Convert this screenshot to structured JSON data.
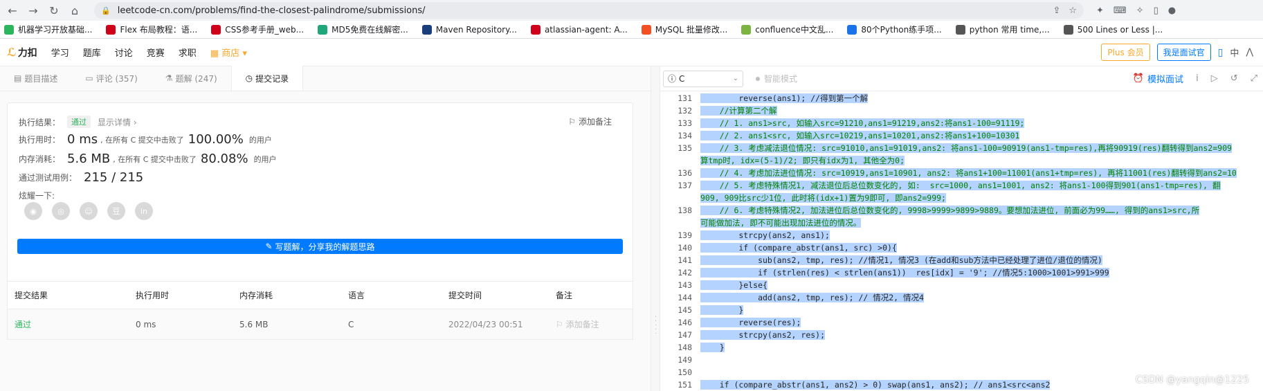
{
  "browser": {
    "url": "leetcode-cn.com/problems/find-the-closest-palindrome/submissions/",
    "bookmarks": [
      {
        "label": "机器学习开放基础...",
        "color": "#2db55d"
      },
      {
        "label": "Flex 布局教程：语...",
        "color": "#d0021b"
      },
      {
        "label": "CSS参考手册_web...",
        "color": "#d0021b"
      },
      {
        "label": "MD5免费在线解密...",
        "color": "#1fa67a"
      },
      {
        "label": "Maven Repository...",
        "color": "#1a3d7c"
      },
      {
        "label": "atlassian-agent: A...",
        "color": "#d0021b"
      },
      {
        "label": "MySQL 批量修改...",
        "color": "#f25022"
      },
      {
        "label": "confluence中文乱...",
        "color": "#7cb342"
      },
      {
        "label": "80个Python练手项...",
        "color": "#1a73e8"
      },
      {
        "label": "python 常用 time,...",
        "color": "#555555"
      },
      {
        "label": "500 Lines or Less |...",
        "color": "#555555"
      }
    ]
  },
  "site": {
    "logo": "力扣",
    "nav": [
      "学习",
      "题库",
      "讨论",
      "竞赛",
      "求职"
    ],
    "shop": "商店",
    "plus": "Plus 会员",
    "interview": "我是面试官",
    "lang": "中"
  },
  "tabs": [
    {
      "label": "题目描述",
      "icon": "▤"
    },
    {
      "label": "评论 (357)",
      "icon": "▭"
    },
    {
      "label": "题解 (247)",
      "icon": "⚗"
    },
    {
      "label": "提交记录",
      "icon": "◷"
    }
  ],
  "result": {
    "status_label": "执行结果：",
    "status": "通过",
    "show_detail": "显示详情 ›",
    "add_note": "添加备注",
    "time_label": "执行用时：",
    "time_value": "0 ms",
    "time_beat_text": ", 在所有 C 提交中击败了",
    "time_beat": "100.00%",
    "users": "的用户",
    "mem_label": "内存消耗：",
    "mem_value": "5.6 MB",
    "mem_beat_text": ", 在所有 C 提交中击败了",
    "mem_beat": "80.08%",
    "cases_label": "通过测试用例：",
    "cases_value": "215 / 215",
    "share_label": "炫耀一下:",
    "write_solution": "写题解，分享我的解题思路"
  },
  "table": {
    "headers": [
      "提交结果",
      "执行用时",
      "内存消耗",
      "语言",
      "提交时间",
      "备注"
    ],
    "rows": [
      {
        "result": "通过",
        "time": "0 ms",
        "mem": "5.6 MB",
        "lang": "C",
        "submitted": "2022/04/23 00:51",
        "note": "添加备注"
      }
    ]
  },
  "editor": {
    "language": "C",
    "smart_mode": "智能模式",
    "mock_interview": "模拟面试",
    "lines": [
      {
        "n": "131",
        "text": "        reverse(ans1); //得到第一个解"
      },
      {
        "n": "",
        "text": "    //计算第二个解"
      },
      {
        "n": "132",
        "text": "    //计算第二个解"
      },
      {
        "n": "133",
        "text": "    // 1. ans1>src, 如输入src=91210,ans1=91219,ans2:将ans1-100=91119;"
      },
      {
        "n": "134",
        "text": "    // 2. ans1<src, 如输入src=10219,ans1=10201,ans2:将ans1+100=10301"
      },
      {
        "n": "135",
        "text": "    // 3. 考虑减法退位情况: src=91010,ans1=91019,ans2: 将ans1-100=90919(ans1-tmp=res),再将90919(res)翻转得到ans2=909"
      },
      {
        "n": "",
        "text": "算tmp时, idx=(5-1)/2; 即只有idx为1, 其他全为0;"
      },
      {
        "n": "136",
        "text": "    // 4. 考虑加法进位情况: src=10919,ans1=10901, ans2: 将ans1+100=11001(ans1+tmp=res), 再将11001(res)翻转得到ans2=10"
      },
      {
        "n": "137",
        "text": "    // 5. 考虑特殊情况1, 减法退位后总位数变化的, 如:  src=1000, ans1=1001, ans2: 将ans1-100得到901(ans1-tmp=res), 翻"
      },
      {
        "n": "",
        "text": "909, 909比src少1位, 此时将(idx+1)置为9即可, 即ans2=999;"
      },
      {
        "n": "138",
        "text": "    // 6. 考虑特殊情况2, 加法进位后总位数变化的, 9998>9999>9899>9889。要想加法进位, 前面必为99……, 得到的ans1>src,所"
      },
      {
        "n": "",
        "text": "可能做加法, 即不可能出现加法进位的情况。"
      },
      {
        "n": "139",
        "text": "        strcpy(ans2, ans1);"
      },
      {
        "n": "140",
        "text": "        if (compare_abstr(ans1, src) >0){"
      },
      {
        "n": "141",
        "text": "            sub(ans2, tmp, res); //情况1, 情况3 (在add和sub方法中已经处理了进位/退位的情况)"
      },
      {
        "n": "142",
        "text": "            if (strlen(res) < strlen(ans1))  res[idx] = '9'; //情况5:1000>1001>991>999"
      },
      {
        "n": "143",
        "text": "        }else{"
      },
      {
        "n": "144",
        "text": "            add(ans2, tmp, res); // 情况2, 情况4"
      },
      {
        "n": "145",
        "text": "        }"
      },
      {
        "n": "146",
        "text": "        reverse(res);"
      },
      {
        "n": "147",
        "text": "        strcpy(ans2, res);"
      },
      {
        "n": "148",
        "text": "    }"
      },
      {
        "n": "149",
        "text": ""
      },
      {
        "n": "150",
        "text": ""
      },
      {
        "n": "151",
        "text": "    if (compare_abstr(ans1, ans2) > 0) swap(ans1, ans2); // ans1<src<ans2"
      }
    ]
  },
  "watermark": "CSDN @yangqin@1225"
}
